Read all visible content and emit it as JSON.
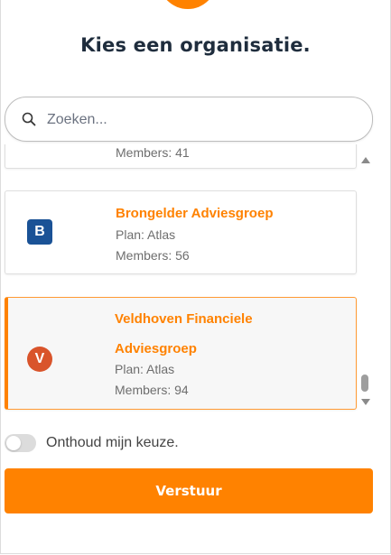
{
  "title": "Kies een organisatie.",
  "search": {
    "placeholder": "Zoeken..."
  },
  "organizations": [
    {
      "name": "",
      "plan": "",
      "members": "Members: 41"
    },
    {
      "name": "Brongelder Adviesgroep",
      "initial": "B",
      "plan": "Plan: Atlas",
      "members": "Members: 56"
    },
    {
      "name_line1": "Veldhoven Financiele",
      "name_line2": "Adviesgroep",
      "initial": "V",
      "plan": "Plan: Atlas",
      "members": "Members: 94",
      "selected": true
    }
  ],
  "remember": {
    "label": "Onthoud mijn keuze.",
    "checked": false
  },
  "submit_label": "Verstuur",
  "colors": {
    "accent": "#ff8200",
    "badge_b": "#1a5296",
    "badge_v": "#d9542b"
  },
  "icons": {
    "search": "search-icon",
    "scroll_up": "arrow-up-icon",
    "scroll_down": "arrow-down-icon"
  }
}
